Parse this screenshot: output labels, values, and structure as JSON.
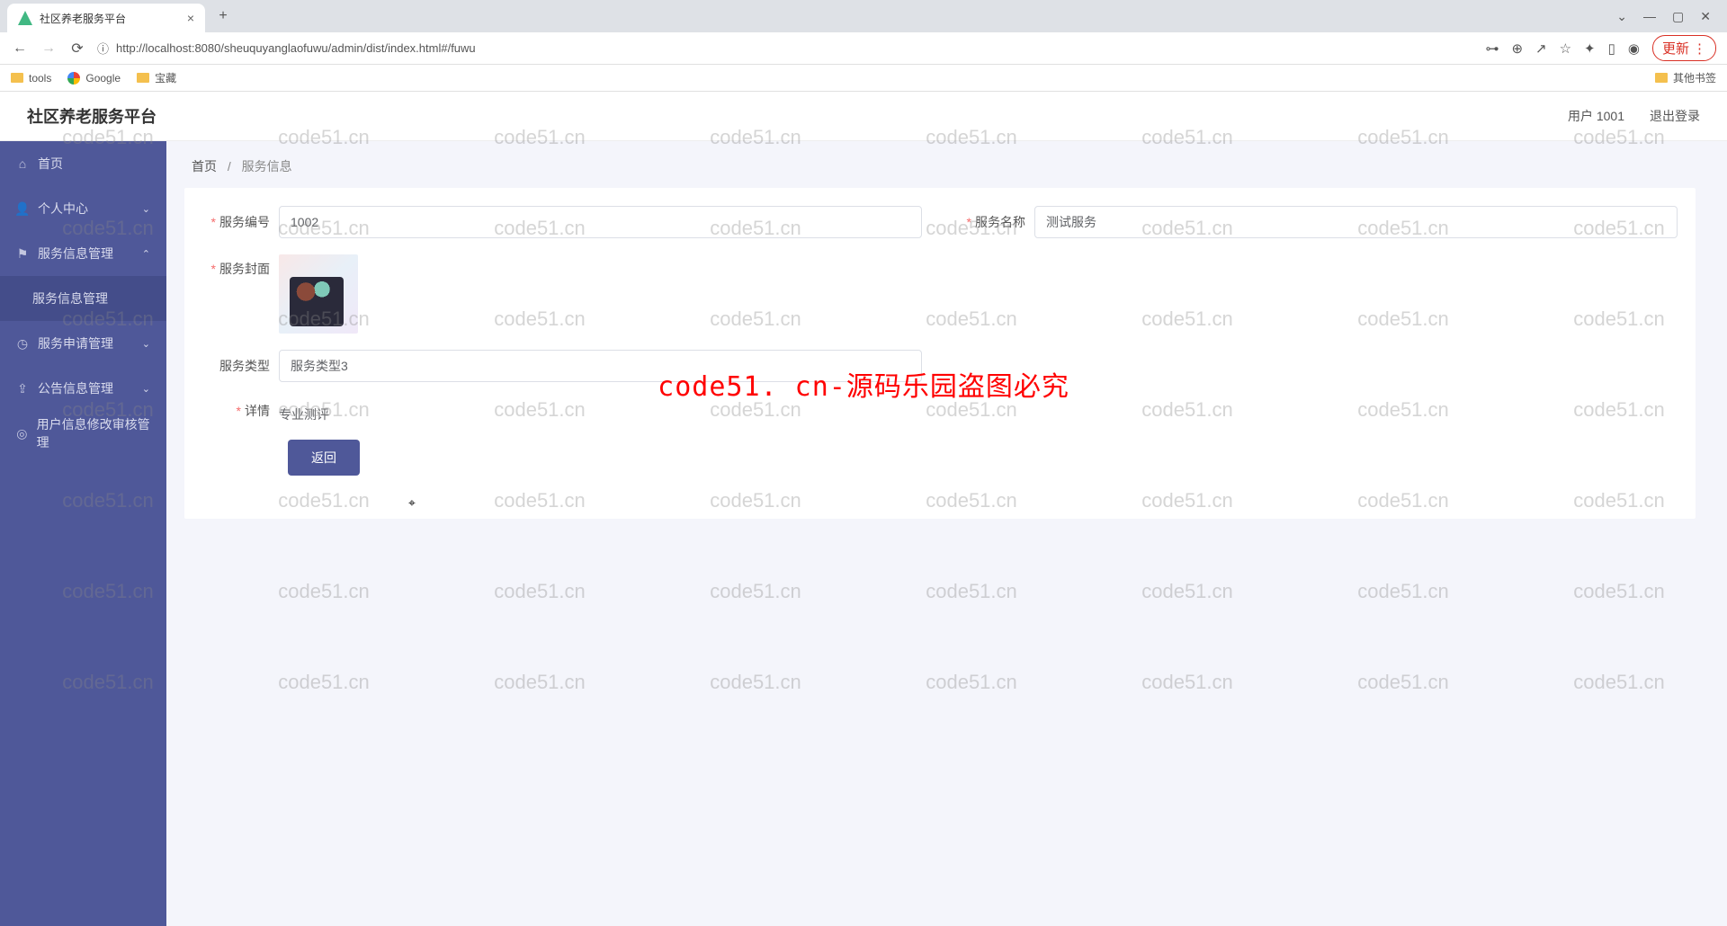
{
  "browser": {
    "tab_title": "社区养老服务平台",
    "url": "http://localhost:8080/sheuquyanglaofuwu/admin/dist/index.html#/fuwu",
    "update_label": "更新",
    "bookmarks": {
      "tools": "tools",
      "google": "Google",
      "baozang": "宝藏",
      "other": "其他书签"
    }
  },
  "header": {
    "title": "社区养老服务平台",
    "user_label": "用户 1001",
    "logout_label": "退出登录"
  },
  "sidebar": {
    "home": "首页",
    "personal": "个人中心",
    "service_mgmt": "服务信息管理",
    "service_sub": "服务信息管理",
    "apply_mgmt": "服务申请管理",
    "notice_mgmt": "公告信息管理",
    "audit_mgmt": "用户信息修改审核管理"
  },
  "breadcrumb": {
    "home": "首页",
    "current": "服务信息"
  },
  "form": {
    "id_label": "服务编号",
    "id_value": "1002",
    "name_label": "服务名称",
    "name_value": "测试服务",
    "cover_label": "服务封面",
    "type_label": "服务类型",
    "type_value": "服务类型3",
    "detail_label": "详情",
    "detail_value": "专业测评",
    "back_label": "返回"
  },
  "watermark": {
    "text": "code51.cn",
    "center": "code51. cn-源码乐园盗图必究"
  }
}
